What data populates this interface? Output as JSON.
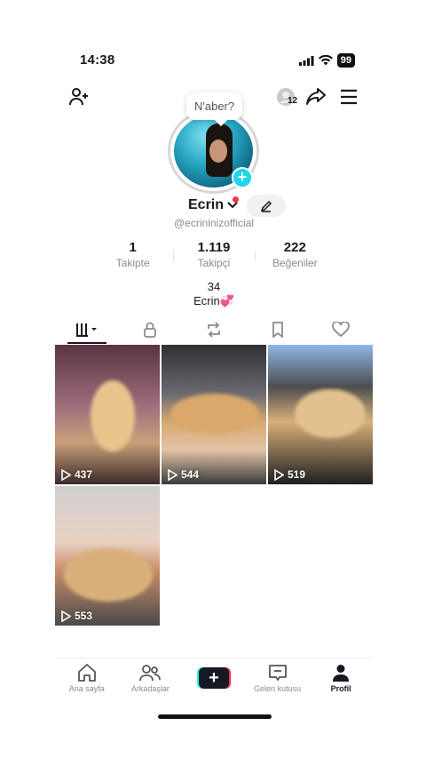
{
  "status_bar": {
    "time": "14:38",
    "battery": "99"
  },
  "header": {
    "notification_count": "12"
  },
  "profile": {
    "bubble_text": "N'aber?",
    "name": "Ecrin",
    "username": "@ecrininizofficial",
    "stats": [
      {
        "value": "1",
        "label": "Takipte"
      },
      {
        "value": "1.119",
        "label": "Takipçi"
      },
      {
        "value": "222",
        "label": "Beğeniler"
      }
    ],
    "bio_line1": "34",
    "bio_line2": "Ecrin💞"
  },
  "videos": [
    {
      "plays": "437"
    },
    {
      "plays": "544"
    },
    {
      "plays": "519"
    },
    {
      "plays": "553"
    }
  ],
  "bottom_nav": [
    {
      "label": "Ana sayfa",
      "icon": "home-icon"
    },
    {
      "label": "Arkadaşlar",
      "icon": "friends-icon"
    },
    {
      "label": "",
      "icon": "create-plus-icon"
    },
    {
      "label": "Gelen kutusu",
      "icon": "inbox-icon"
    },
    {
      "label": "Profil",
      "icon": "profile-icon"
    }
  ],
  "colors": {
    "accent_cyan": "#20d5ec",
    "accent_red": "#fe2c55",
    "text": "#161823",
    "muted": "#8a8b91"
  }
}
